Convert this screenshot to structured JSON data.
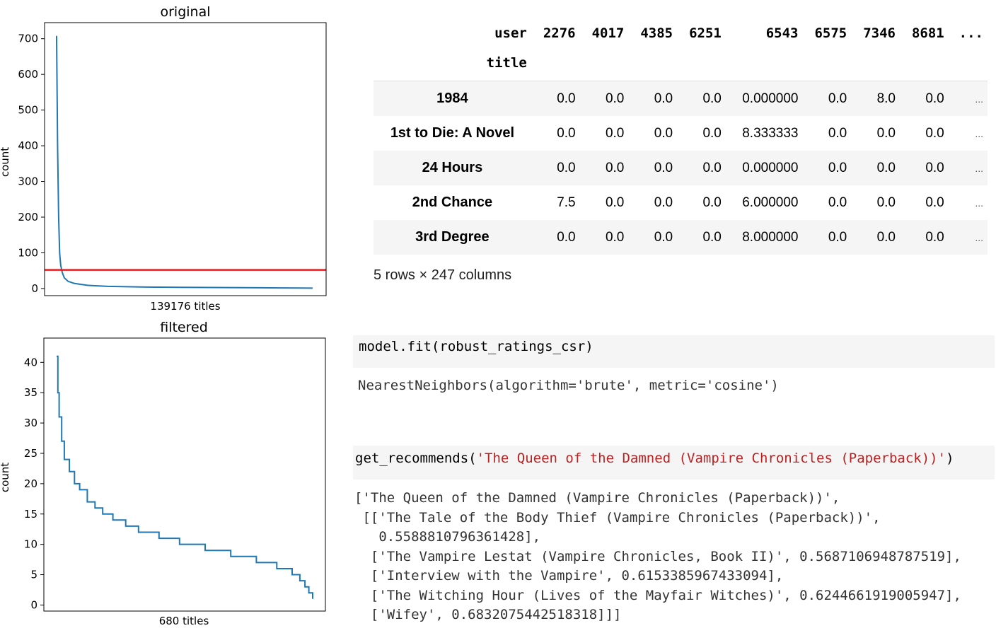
{
  "chart_data": [
    {
      "type": "line",
      "title": "original",
      "xlabel": "139176 titles",
      "ylabel": "count",
      "ylim": [
        -20,
        745
      ],
      "yticks": [
        0,
        100,
        200,
        300,
        400,
        500,
        600,
        700
      ],
      "x": [
        0,
        0.004,
        0.008,
        0.012,
        0.016,
        0.022,
        0.03,
        0.045,
        0.07,
        0.12,
        0.2,
        0.35,
        0.55,
        0.8,
        1.0
      ],
      "series": [
        {
          "values": [
            708,
            400,
            200,
            100,
            65,
            45,
            30,
            20,
            14,
            9,
            6,
            4,
            3,
            2,
            1
          ]
        }
      ],
      "threshold_line": 52,
      "grid": false,
      "colors": {
        "line": "#1f77b4",
        "threshold": "#e02020"
      }
    },
    {
      "type": "line",
      "title": "filtered",
      "xlabel": "680 titles",
      "ylabel": "count",
      "ylim": [
        -1,
        44
      ],
      "yticks": [
        0,
        5,
        10,
        15,
        20,
        25,
        30,
        35,
        40
      ],
      "x": [
        0,
        0.005,
        0.01,
        0.02,
        0.03,
        0.05,
        0.07,
        0.09,
        0.12,
        0.15,
        0.18,
        0.22,
        0.27,
        0.32,
        0.4,
        0.48,
        0.58,
        0.68,
        0.78,
        0.86,
        0.92,
        0.95,
        0.97,
        0.985,
        1.0
      ],
      "series": [
        {
          "values": [
            41,
            35,
            31,
            27,
            24,
            22,
            20,
            19,
            17,
            16,
            15,
            14,
            13,
            12,
            11,
            10,
            9,
            8,
            7,
            6,
            5,
            4,
            3,
            2,
            1
          ]
        }
      ],
      "grid": false,
      "colors": {
        "line": "#1f77b4"
      }
    }
  ],
  "dataframe": {
    "columns_name": "user",
    "index_name": "title",
    "columns": [
      "2276",
      "4017",
      "4385",
      "6251",
      "6543",
      "6575",
      "7346",
      "8681",
      "..."
    ],
    "rows": [
      {
        "title": "1984",
        "values": [
          "0.0",
          "0.0",
          "0.0",
          "0.0",
          "0.000000",
          "0.0",
          "8.0",
          "0.0",
          "..."
        ]
      },
      {
        "title": "1st to Die: A Novel",
        "values": [
          "0.0",
          "0.0",
          "0.0",
          "0.0",
          "8.333333",
          "0.0",
          "0.0",
          "0.0",
          "..."
        ]
      },
      {
        "title": "24 Hours",
        "values": [
          "0.0",
          "0.0",
          "0.0",
          "0.0",
          "0.000000",
          "0.0",
          "0.0",
          "0.0",
          "..."
        ]
      },
      {
        "title": "2nd Chance",
        "values": [
          "7.5",
          "0.0",
          "0.0",
          "0.0",
          "6.000000",
          "0.0",
          "0.0",
          "0.0",
          "..."
        ]
      },
      {
        "title": "3rd Degree",
        "values": [
          "0.0",
          "0.0",
          "0.0",
          "0.0",
          "8.000000",
          "0.0",
          "0.0",
          "0.0",
          "..."
        ]
      }
    ],
    "shape_note": "5 rows × 247 columns"
  },
  "cells": {
    "fit_code": "model.fit(robust_ratings_csr)",
    "fit_output": "NearestNeighbors(algorithm='brute', metric='cosine')",
    "rec_code_fn": "get_recommends(",
    "rec_code_arg": "'The Queen of the Damned (Vampire Chronicles (Paperback))'",
    "rec_code_close": ")",
    "rec_output_lines": [
      "['The Queen of the Damned (Vampire Chronicles (Paperback))',",
      " [['The Tale of the Body Thief (Vampire Chronicles (Paperback))',",
      "   0.5588810796361428],",
      "  ['The Vampire Lestat (Vampire Chronicles, Book II)', 0.5687106948787519],",
      "  ['Interview with the Vampire', 0.6153385967433094],",
      "  ['The Witching Hour (Lives of the Mayfair Witches)', 0.6244661919005947],",
      "  ['Wifey', 0.6832075442518318]]]"
    ]
  }
}
